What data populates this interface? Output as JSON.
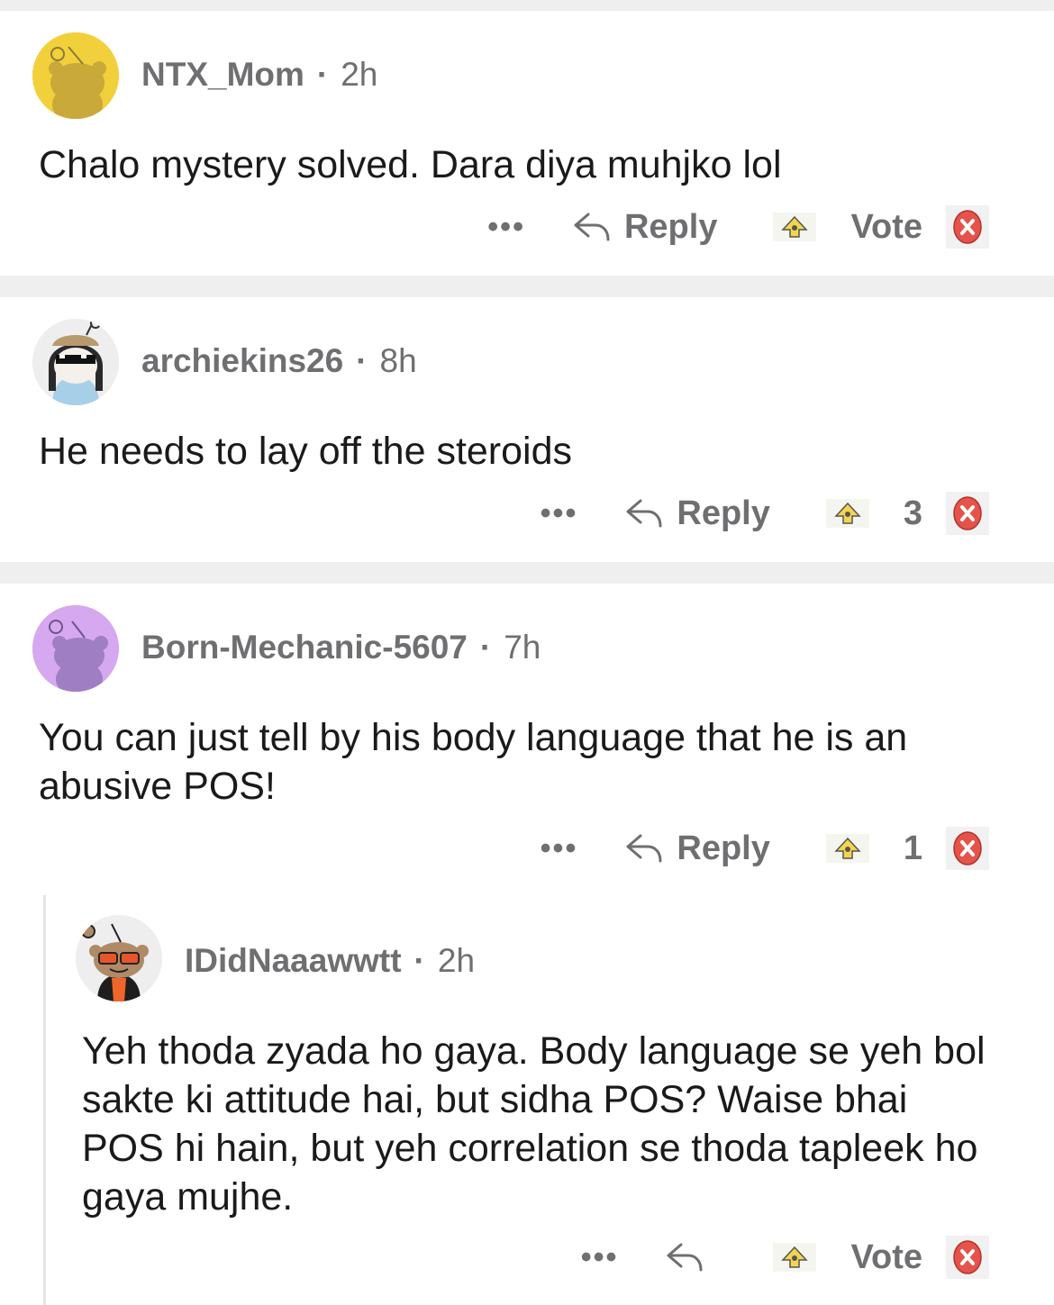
{
  "comments": [
    {
      "username": "NTX_Mom",
      "time": "2h",
      "text": "Chalo mystery solved. Dara diya muhjko lol",
      "more": "•••",
      "reply": "Reply",
      "votes": "Vote",
      "avatar_color": "#f2d03b"
    },
    {
      "username": "archiekins26",
      "time": "8h",
      "text": "He needs to lay off the steroids",
      "more": "•••",
      "reply": "Reply",
      "votes": "3",
      "avatar_color": "#eeeeef"
    },
    {
      "username": "Born-Mechanic-5607",
      "time": "7h",
      "text": "You can just tell by his body language that he is an abusive POS!",
      "more": "•••",
      "reply": "Reply",
      "votes": "1",
      "avatar_color": "#d6a8f0"
    },
    {
      "username": "IDidNaaawwtt",
      "time": "2h",
      "text": "Yeh thoda zyada ho gaya. Body language se yeh bol sakte ki attitude hai, but sidha POS? Waise bhai POS hi hain, but yeh correlation se thoda tapleek ho gaya mujhe.",
      "more": "•••",
      "reply": "",
      "votes": "Vote",
      "avatar_color": "#eeeeef"
    }
  ],
  "icons": {
    "reply": "reply-arrow-icon",
    "upvote": "upvote-icon",
    "downvote": "downvote-icon",
    "more": "more-icon"
  }
}
